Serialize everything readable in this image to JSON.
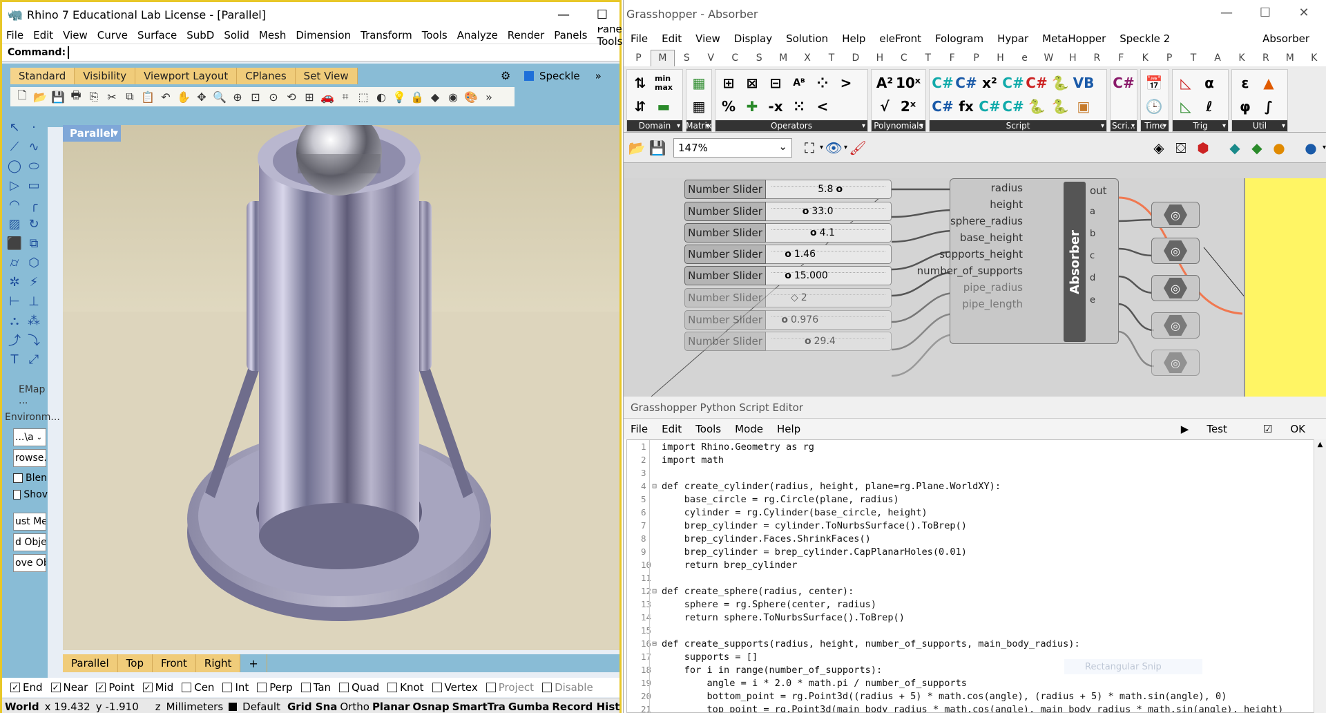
{
  "rhino": {
    "title": "Rhino 7 Educational Lab License - [Parallel]",
    "menu": [
      "File",
      "Edit",
      "View",
      "Curve",
      "Surface",
      "SubD",
      "Solid",
      "Mesh",
      "Dimension",
      "Transform",
      "Tools",
      "Analyze",
      "Render",
      "Panels",
      "Paneling Tools"
    ],
    "command_label": "Command:",
    "toolbar_tabs": [
      "Standard",
      "Visibility",
      "Viewport Layout",
      "CPlanes",
      "Set View"
    ],
    "plugin_tab": "Speckle",
    "viewport_label": "Parallel",
    "viewport_tabs": [
      "Parallel",
      "Top",
      "Front",
      "Right"
    ],
    "side_panel": {
      "emap": "EMap ...",
      "environment": "Environm...",
      "dropdown": "...\\a",
      "browse": "rowse.",
      "blend": "Blen",
      "show": "Shov",
      "buttons": [
        "ust Me",
        "d Obje",
        "ove Ob"
      ]
    },
    "osnaps": [
      {
        "label": "End",
        "checked": true
      },
      {
        "label": "Near",
        "checked": true
      },
      {
        "label": "Point",
        "checked": true
      },
      {
        "label": "Mid",
        "checked": true
      },
      {
        "label": "Cen",
        "checked": false
      },
      {
        "label": "Int",
        "checked": false
      },
      {
        "label": "Perp",
        "checked": false
      },
      {
        "label": "Tan",
        "checked": false
      },
      {
        "label": "Quad",
        "checked": false
      },
      {
        "label": "Knot",
        "checked": false
      },
      {
        "label": "Vertex",
        "checked": false
      },
      {
        "label": "Project",
        "checked": false
      },
      {
        "label": "Disable",
        "checked": false
      }
    ],
    "status": {
      "cplane": "World",
      "x": "x 19.432",
      "y": "y -1.910",
      "z": "z",
      "units": "Millimeters",
      "layer": "Default",
      "modes": [
        "Grid Sna",
        "Ortho",
        "Planar",
        "Osnap",
        "SmartTra",
        "Gumba",
        "Record Hist"
      ]
    }
  },
  "grasshopper": {
    "title": "Grasshopper - Absorber",
    "menu": [
      "File",
      "Edit",
      "View",
      "Display",
      "Solution",
      "Help",
      "eleFront",
      "Fologram",
      "Hypar",
      "MetaHopper",
      "Speckle 2"
    ],
    "document": "Absorber",
    "tabs": [
      "P",
      "M",
      "S",
      "V",
      "C",
      "S",
      "M",
      "X",
      "T",
      "D",
      "H",
      "C",
      "T",
      "F",
      "P",
      "H",
      "e",
      "W",
      "H",
      "R",
      "F",
      "K",
      "P",
      "T",
      "A",
      "K",
      "R",
      "M",
      "K"
    ],
    "groups": [
      "Domain",
      "Matrix",
      "Operators",
      "Polynomials",
      "Script",
      "Scri...",
      "Time",
      "Trig",
      "Util"
    ],
    "zoom": "147%",
    "sliders": [
      {
        "name": "Number Slider",
        "value": "5.8",
        "frac": 0.42
      },
      {
        "name": "Number Slider",
        "value": "33.0",
        "frac": 0.28
      },
      {
        "name": "Number Slider",
        "value": "4.1",
        "frac": 0.35
      },
      {
        "name": "Number Slider",
        "value": "1.46",
        "frac": 0.12
      },
      {
        "name": "Number Slider",
        "value": "15.000",
        "frac": 0.12
      },
      {
        "name": "Number Slider",
        "value": "2",
        "frac": 0.15
      },
      {
        "name": "Number Slider",
        "value": "0.976",
        "frac": 0.09
      },
      {
        "name": "Number Slider",
        "value": "29.4",
        "frac": 0.3
      }
    ],
    "component": {
      "name": "Absorber",
      "inputs": [
        "radius",
        "height",
        "sphere_radius",
        "base_height",
        "supports_height",
        "number_of_supports",
        "pipe_radius",
        "pipe_length"
      ],
      "outputs": [
        "out",
        "a",
        "b",
        "c",
        "d",
        "e"
      ]
    }
  },
  "python_editor": {
    "title": "Grasshopper Python Script Editor",
    "menu": [
      "File",
      "Edit",
      "Tools",
      "Mode",
      "Help"
    ],
    "test_label": "Test",
    "ok_label": "OK",
    "overlay_hint": "Rectangular Snip",
    "code": [
      "import Rhino.Geometry as rg",
      "import math",
      "",
      "def create_cylinder(radius, height, plane=rg.Plane.WorldXY):",
      "    base_circle = rg.Circle(plane, radius)",
      "    cylinder = rg.Cylinder(base_circle, height)",
      "    brep_cylinder = cylinder.ToNurbsSurface().ToBrep()",
      "    brep_cylinder.Faces.ShrinkFaces()",
      "    brep_cylinder = brep_cylinder.CapPlanarHoles(0.01)",
      "    return brep_cylinder",
      "",
      "def create_sphere(radius, center):",
      "    sphere = rg.Sphere(center, radius)",
      "    return sphere.ToNurbsSurface().ToBrep()",
      "",
      "def create_supports(radius, height, number_of_supports, main_body_radius):",
      "    supports = []",
      "    for i in range(number_of_supports):",
      "        angle = i * 2.0 * math.pi / number_of_supports",
      "        bottom_point = rg.Point3d((radius + 5) * math.cos(angle), (radius + 5) * math.sin(angle), 0)",
      "        top_point = rg.Point3d(main_body_radius * math.cos(angle), main_body_radius * math.sin(angle), height)"
    ]
  }
}
